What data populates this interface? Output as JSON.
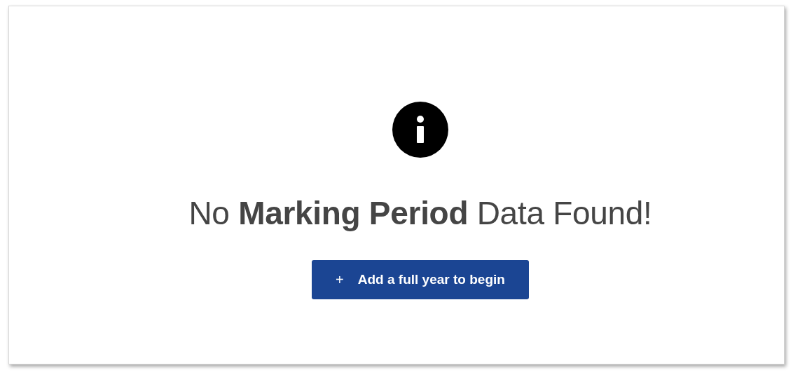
{
  "empty_state": {
    "heading": "No **Marking Period** Data Found!",
    "button": {
      "icon": "+",
      "label": "Add a full year to begin"
    }
  }
}
